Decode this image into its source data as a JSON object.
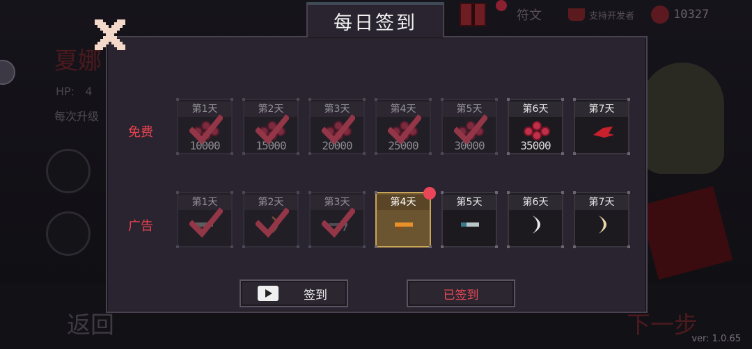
{
  "background": {
    "topbar": {
      "rune_label": "符文",
      "support_label": "支持开发者",
      "currency_value": "10327"
    },
    "character": {
      "name": "夏娜",
      "hp_label": "HP:",
      "hp_value": "4",
      "desc": "每次升级"
    },
    "back_label": "返回",
    "next_label": "下一步",
    "version": "ver: 1.0.65"
  },
  "dialog": {
    "title": "每日签到",
    "rows": [
      {
        "label": "免费",
        "days": [
          {
            "label": "第1天",
            "amount": "10000",
            "reward": "coin",
            "claimed": true
          },
          {
            "label": "第2天",
            "amount": "15000",
            "reward": "coin",
            "claimed": true
          },
          {
            "label": "第3天",
            "amount": "20000",
            "reward": "coin",
            "claimed": true
          },
          {
            "label": "第4天",
            "amount": "25000",
            "reward": "coin",
            "claimed": true
          },
          {
            "label": "第5天",
            "amount": "30000",
            "reward": "coin",
            "claimed": true
          },
          {
            "label": "第6天",
            "amount": "35000",
            "reward": "coin",
            "claimed": false
          },
          {
            "label": "第7天",
            "amount": "",
            "reward": "red-wing-item",
            "claimed": false
          }
        ]
      },
      {
        "label": "广告",
        "days": [
          {
            "label": "第1天",
            "amount": "",
            "reward": "gun-item",
            "claimed": true
          },
          {
            "label": "第2天",
            "amount": "",
            "reward": "bow-item",
            "claimed": true
          },
          {
            "label": "第3天",
            "amount": "",
            "reward": "crossbow-item",
            "claimed": true
          },
          {
            "label": "第4天",
            "amount": "",
            "reward": "orange-gun-item",
            "claimed": false,
            "today": true
          },
          {
            "label": "第5天",
            "amount": "",
            "reward": "blue-gun-item",
            "claimed": false
          },
          {
            "label": "第6天",
            "amount": "",
            "reward": "crescent-blade-item",
            "claimed": false
          },
          {
            "label": "第7天",
            "amount": "",
            "reward": "golden-crescent-item",
            "claimed": false
          }
        ]
      }
    ],
    "ad_button_label": "签到",
    "signed_button_label": "已签到"
  },
  "colors": {
    "accent_red": "#e8434f",
    "panel_bg": "#2a2430",
    "today_gold": "#c9a55a",
    "check_red": "#e9465a"
  }
}
